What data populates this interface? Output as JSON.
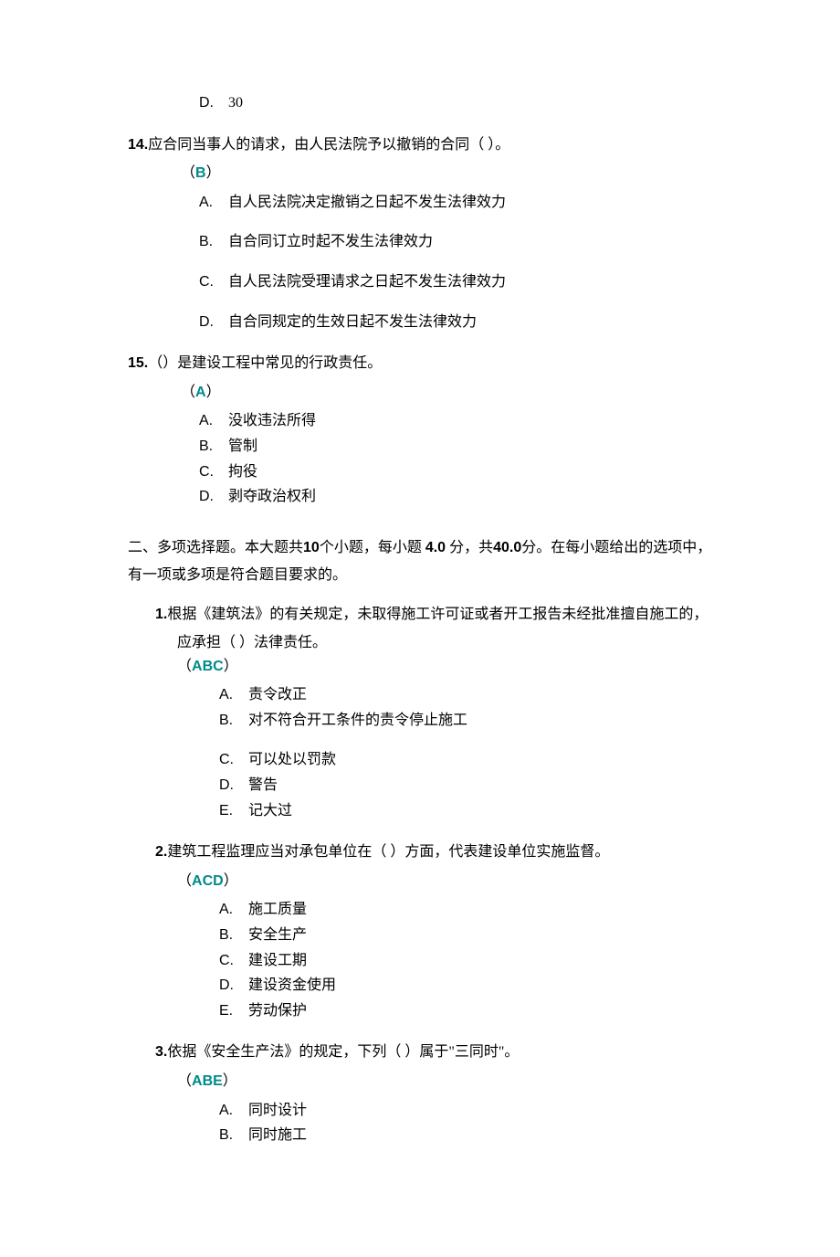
{
  "q13": {
    "optD": {
      "letter": "D.",
      "text": "30"
    }
  },
  "q14": {
    "num": "14.",
    "stem": "应合同当事人的请求，由人民法院予以撤销的合同（ ）。",
    "paren_open": "（",
    "answer": "B",
    "paren_close": "）",
    "opts": [
      {
        "letter": "A.",
        "text": "自人民法院决定撤销之日起不发生法律效力"
      },
      {
        "letter": "B.",
        "text": "自合同订立时起不发生法律效力"
      },
      {
        "letter": "C.",
        "text": "自人民法院受理请求之日起不发生法律效力"
      },
      {
        "letter": "D.",
        "text": "自合同规定的生效日起不发生法律效力"
      }
    ]
  },
  "q15": {
    "num": "15.",
    "stem": "（）是建设工程中常见的行政责任。",
    "paren_open": "（",
    "answer": "A",
    "paren_close": "）",
    "opts": [
      {
        "letter": "A.",
        "text": "没收违法所得"
      },
      {
        "letter": "B.",
        "text": "管制"
      },
      {
        "letter": "C.",
        "text": "拘役"
      },
      {
        "letter": "D.",
        "text": "剥夺政治权利"
      }
    ]
  },
  "section2": {
    "pre1": "二、多项选择题。本大题共",
    "n1": "10",
    "mid1": "个小题，每小题 ",
    "n2": "4.0",
    "mid2": " 分，共",
    "n3": "40.0",
    "post": "分。在每小题给出的选项中，有一项或多项是符合题目要求的。"
  },
  "mq1": {
    "num": "1.",
    "stem": "根据《建筑法》的有关规定，未取得施工许可证或者开工报告未经批准擅自施工的，",
    "stem2": "应承担（ ）法律责任。",
    "paren_open": "（",
    "answer": "ABC",
    "paren_close": "）",
    "opts": [
      {
        "letter": "A.",
        "text": "责令改正"
      },
      {
        "letter": "B.",
        "text": "对不符合开工条件的责令停止施工"
      },
      {
        "letter": "C.",
        "text": "可以处以罚款"
      },
      {
        "letter": "D.",
        "text": "警告"
      },
      {
        "letter": "E.",
        "text": "记大过"
      }
    ]
  },
  "mq2": {
    "num": "2.",
    "stem": "建筑工程监理应当对承包单位在（ ）方面，代表建设单位实施监督。",
    "paren_open": "（",
    "answer": "ACD",
    "paren_close": "）",
    "opts": [
      {
        "letter": "A.",
        "text": "施工质量"
      },
      {
        "letter": "B.",
        "text": "安全生产"
      },
      {
        "letter": "C.",
        "text": "建设工期"
      },
      {
        "letter": "D.",
        "text": "建设资金使用"
      },
      {
        "letter": "E.",
        "text": "劳动保护"
      }
    ]
  },
  "mq3": {
    "num": "3.",
    "stem": "依据《安全生产法》的规定，下列（ ）属于\"三同时\"。",
    "paren_open": "（",
    "answer": "ABE",
    "paren_close": "）",
    "opts": [
      {
        "letter": "A.",
        "text": "同时设计"
      },
      {
        "letter": "B.",
        "text": "同时施工"
      }
    ]
  }
}
